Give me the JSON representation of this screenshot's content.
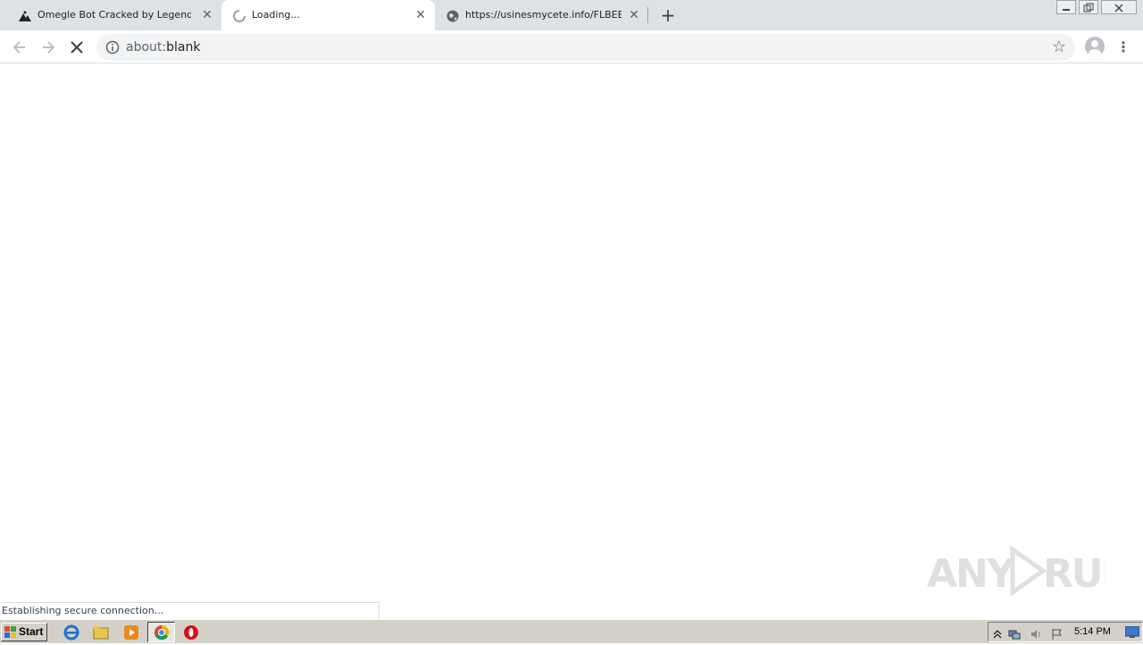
{
  "browser": {
    "tabs": [
      {
        "title": "Omegle Bot Cracked by Legend and",
        "close_glyph": "✕",
        "favicon": "omegle-icon"
      },
      {
        "title": "Loading...",
        "close_glyph": "✕",
        "favicon": "loading-spinner-icon"
      },
      {
        "title": "https://usinesmycete.info/FLBEBTK?",
        "close_glyph": "✕",
        "favicon": "globe-icon"
      }
    ],
    "new_tab_glyph": "+",
    "address": {
      "scheme": "about:",
      "rest": "blank"
    },
    "status_text": "Establishing secure connection..."
  },
  "watermark": {
    "text": "ANY RUN"
  },
  "taskbar": {
    "start_label": "Start",
    "clock": "5:14 PM"
  },
  "colors": {
    "tab_strip": "#dee1e6",
    "omnibox": "#f1f3f4",
    "taskbar": "#d4d0c8"
  }
}
